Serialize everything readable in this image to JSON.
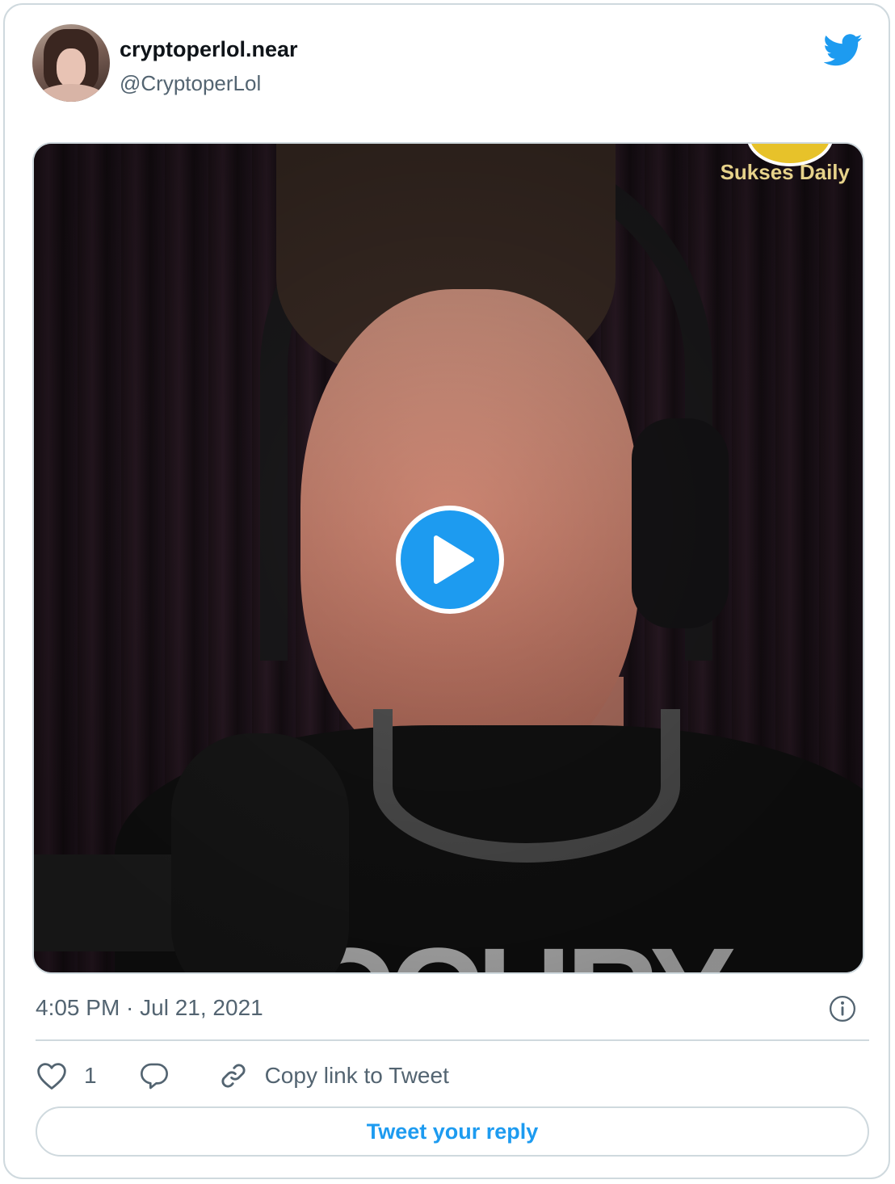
{
  "tweet": {
    "author_name": "cryptoperlol.near",
    "author_handle": "@CryptoperLol",
    "timestamp": "4:05 PM · Jul 21, 2021",
    "likes_count": "1",
    "copy_link_label": "Copy link to Tweet",
    "reply_button_label": "Tweet your reply"
  },
  "media": {
    "watermark": "Sukses Daily",
    "shirt_text": "CCURY"
  },
  "icons": {
    "brand": "twitter-bird-icon",
    "play": "play-icon",
    "info": "info-icon",
    "like": "heart-icon",
    "reply": "reply-bubble-icon",
    "link": "link-icon"
  },
  "colors": {
    "accent": "#1d9bf0",
    "secondary_text": "#536471",
    "border": "#cfd9de"
  }
}
